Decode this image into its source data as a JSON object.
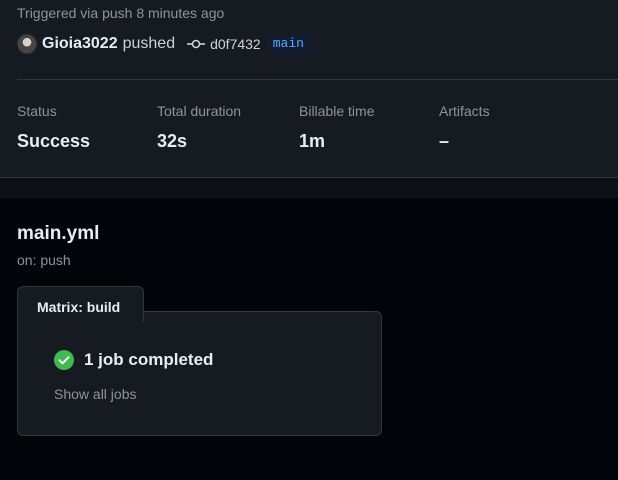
{
  "run": {
    "trigger_text": "Triggered via push 8 minutes ago",
    "user": "Gioia3022",
    "action": "pushed",
    "commit_sha": "d0f7432",
    "branch": "main"
  },
  "stats": [
    {
      "label": "Status",
      "value": "Success"
    },
    {
      "label": "Total duration",
      "value": "32s"
    },
    {
      "label": "Billable time",
      "value": "1m"
    },
    {
      "label": "Artifacts",
      "value": "–"
    }
  ],
  "workflow": {
    "file": "main.yml",
    "trigger": "on: push",
    "matrix_label": "Matrix: build",
    "job_status": "1 job completed",
    "show_all": "Show all jobs"
  },
  "colors": {
    "success": "#3fb950",
    "link": "#58a6ff",
    "muted": "#8b949e"
  },
  "icons": {
    "avatar": "user-avatar",
    "commit": "git-commit-icon",
    "job_status": "check-circle-icon"
  }
}
